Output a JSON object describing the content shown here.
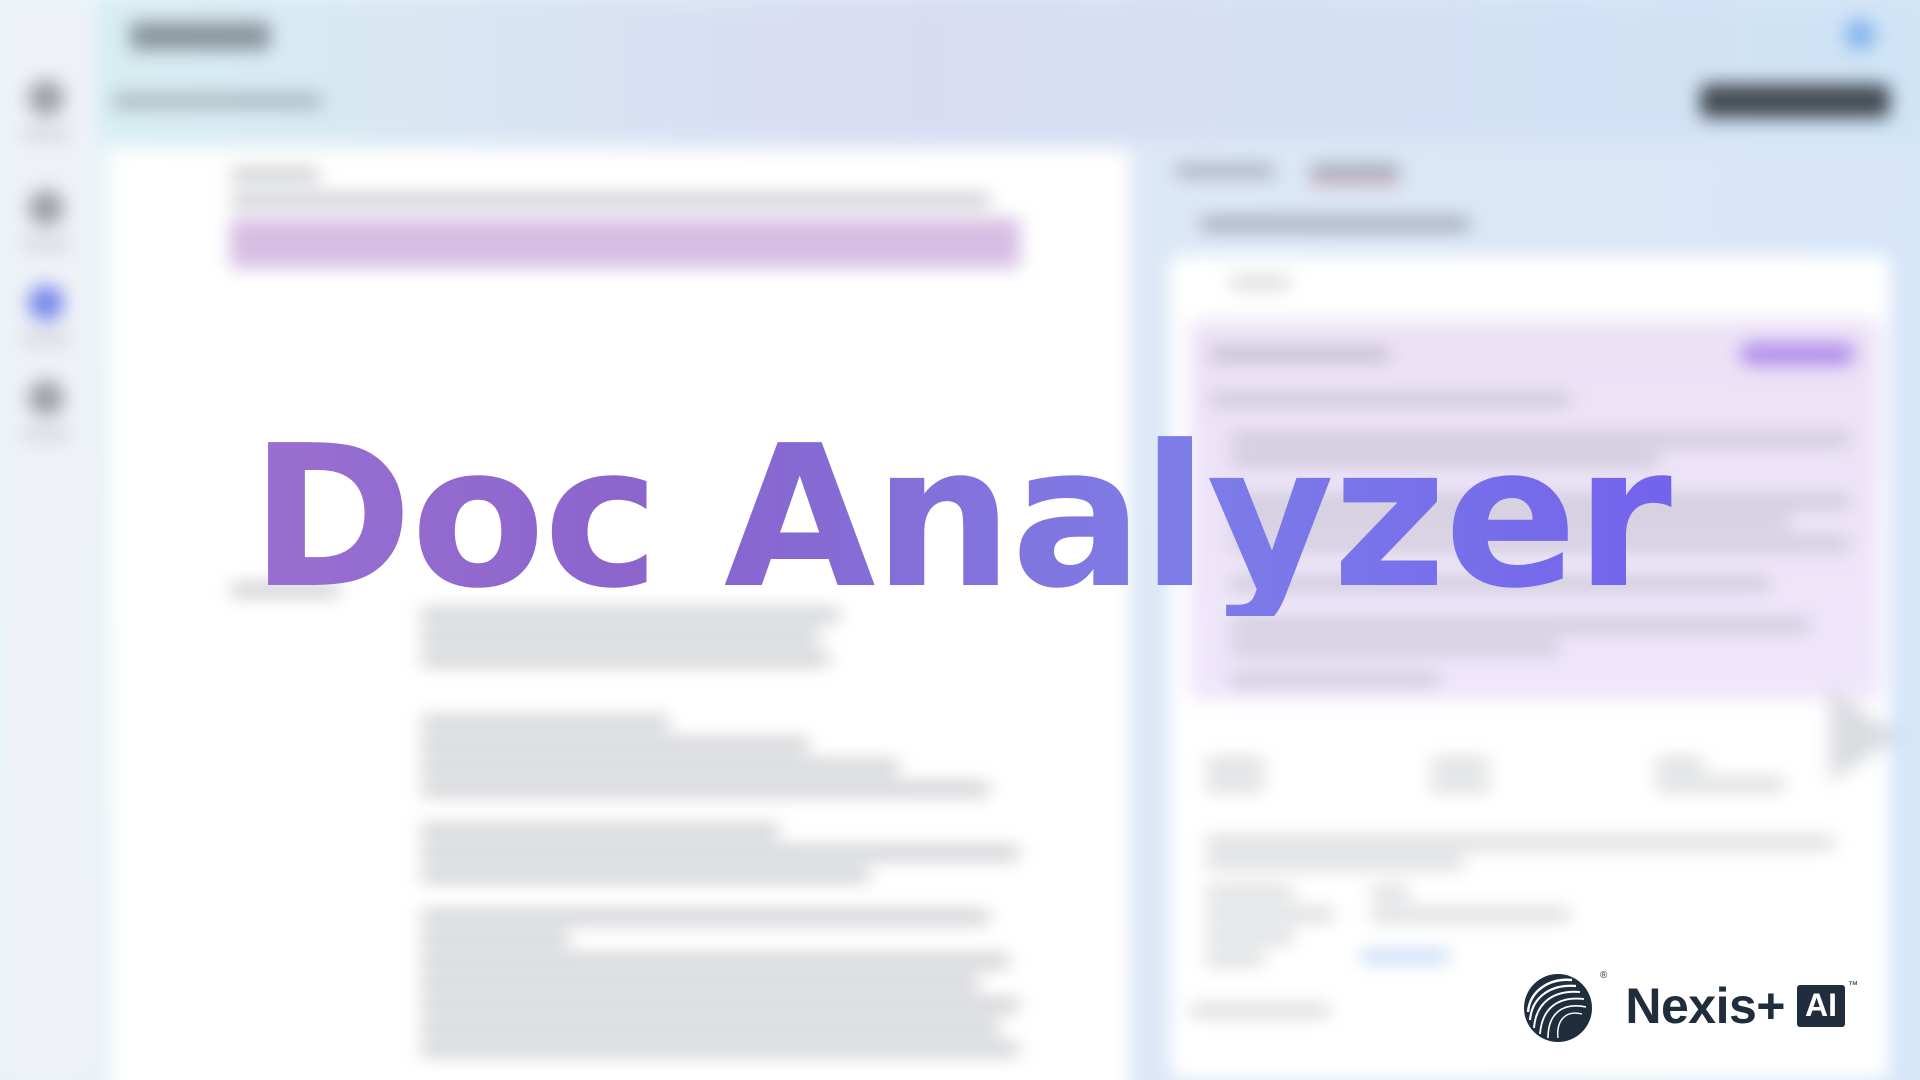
{
  "title": "Doc Analyzer",
  "brand": {
    "name": "Nexis+",
    "badge": "AI",
    "registered_mark": "®",
    "trademark": "™",
    "logo_icon": "lexisnexis-logo-icon"
  },
  "colors": {
    "title_gradient_start": "#a276d3",
    "title_gradient_end": "#6e56ee",
    "brand_dark": "#1f2d3d"
  }
}
